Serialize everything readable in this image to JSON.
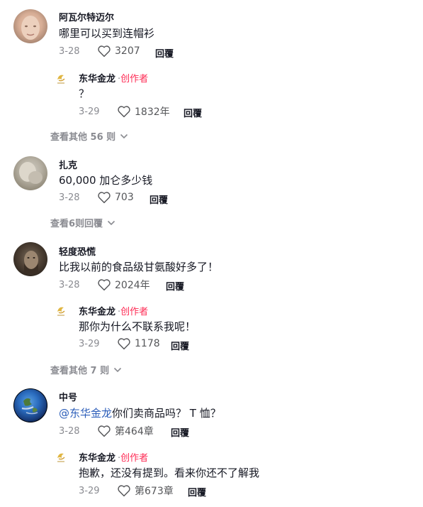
{
  "comments": [
    {
      "username": "阿瓦尔特迈尔",
      "text": "哪里可以买到连帽衫",
      "date": "3-28",
      "likes": "3207",
      "reply_label": "回覆",
      "replies": [
        {
          "username": "东华金龙",
          "creator_label": "创作者",
          "text": "？",
          "date": "3-29",
          "likes": "1832年",
          "reply_label": "回覆"
        }
      ],
      "more_label": "查看其他 56 则"
    },
    {
      "username": "扎克",
      "text": "60,000 加仑多少钱",
      "date": "3-28",
      "likes": "703",
      "reply_label": "回覆",
      "more_label": "查看6则回覆"
    },
    {
      "username": "轻度恐慌",
      "text": "比我以前的食品级甘氨酸好多了！",
      "date": "3-28",
      "likes": "2024年",
      "reply_label": "回覆",
      "replies": [
        {
          "username": "东华金龙",
          "creator_label": "创作者",
          "text": "那你为什么不联系我呢！",
          "date": "3-29",
          "likes": "1178",
          "reply_label": "回覆"
        }
      ],
      "more_label": "查看其他 7 则"
    },
    {
      "username": "中号",
      "mention": "@东华金龙",
      "text": "你们卖商品吗？ T 恤？",
      "date": "3-28",
      "likes": "第464章",
      "reply_label": "回覆",
      "replies": [
        {
          "username": "东华金龙",
          "creator_label": "创作者",
          "text": "抱歉，还没有提到。看来你还不了解我",
          "date": "3-29",
          "likes": "第673章",
          "reply_label": "回覆"
        }
      ]
    }
  ],
  "creator_dot": "·",
  "colors": {
    "creator": "#fe2c55",
    "mention": "#2b5db9",
    "meta": "#8a8b91"
  }
}
